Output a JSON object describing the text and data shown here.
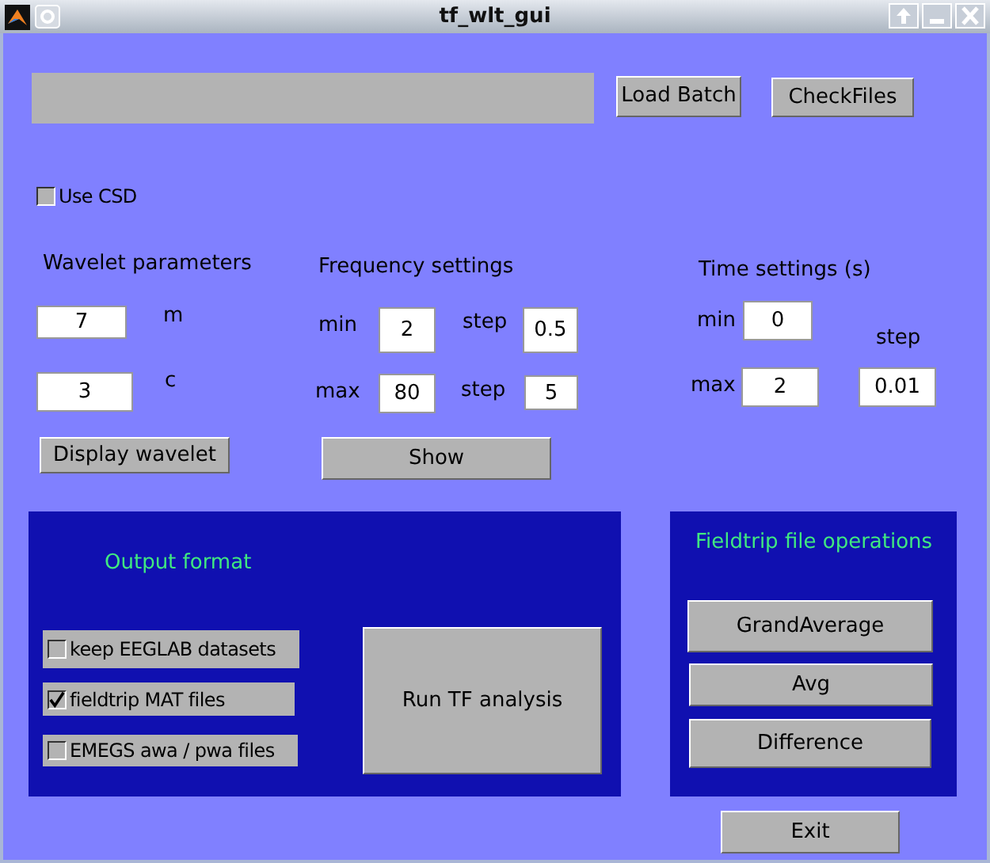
{
  "window": {
    "title": "tf_wlt_gui"
  },
  "top_buttons": [
    "Load Batch",
    "CheckFiles"
  ],
  "use_csd": {
    "label": "Use CSD",
    "checked": false
  },
  "wavelet": {
    "title": "Wavelet parameters",
    "m_label": "m",
    "m_value": "7",
    "c_label": "c",
    "c_value": "3",
    "button": "Display wavelet"
  },
  "frequency": {
    "title": "Frequency settings",
    "min_label": "min",
    "min_value": "2",
    "min_step_label": "step",
    "min_step_value": "0.5",
    "max_label": "max",
    "max_value": "80",
    "max_step_label": "step",
    "max_step_value": "5",
    "button": "Show"
  },
  "time": {
    "title": "Time settings (s)",
    "min_label": "min",
    "min_value": "0",
    "step_label": "step",
    "max_label": "max",
    "max_value": "2",
    "step_value": "0.01"
  },
  "output_panel": {
    "title": "Output format",
    "options": [
      {
        "label": "keep EEGLAB datasets",
        "checked": false
      },
      {
        "label": "fieldtrip MAT files",
        "checked": true
      },
      {
        "label": "EMEGS awa / pwa files",
        "checked": false
      }
    ],
    "run_button": "Run TF analysis"
  },
  "fieldtrip_panel": {
    "title": "Fieldtrip file operations",
    "buttons": [
      "GrandAverage",
      "Avg",
      "Difference"
    ]
  },
  "exit_button": "Exit"
}
